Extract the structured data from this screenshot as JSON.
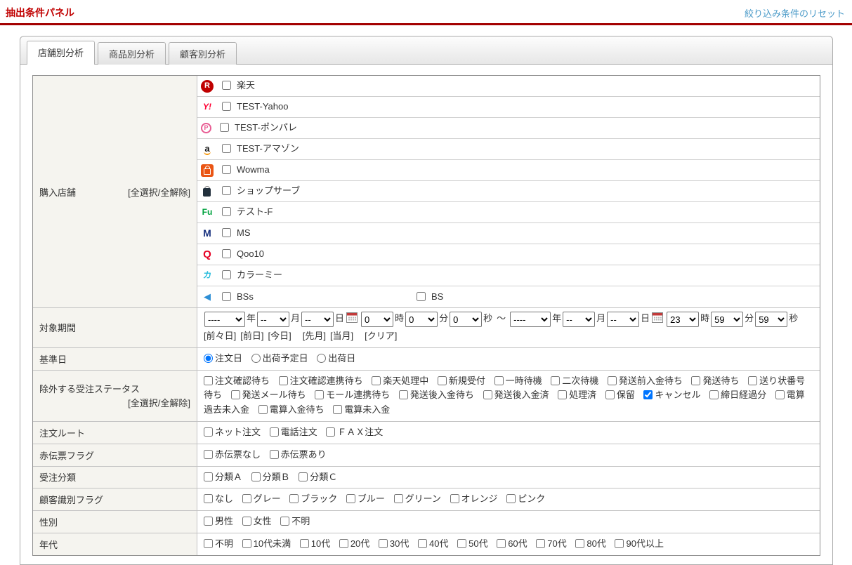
{
  "colors": {
    "title_red": "#c00000",
    "divider_red": "#a30000",
    "link_blue": "#4a9ac8",
    "checked_blue": "#1a73e8",
    "rakuten_red": "#bf0000",
    "wowma_orange": "#ea5514"
  },
  "page": {
    "title": "抽出条件パネル",
    "reset_link": "絞り込み条件のリセット"
  },
  "tabs": [
    {
      "label": "店舗別分析",
      "active": true
    },
    {
      "label": "商品別分析",
      "active": false
    },
    {
      "label": "顧客別分析",
      "active": false
    }
  ],
  "store_row": {
    "label": "購入店舗",
    "select_all_label": "[全選択/全解除]",
    "stores": [
      {
        "icon": "rakuten",
        "icon_text": "R",
        "label": "楽天"
      },
      {
        "icon": "yahoo",
        "icon_text": "Y!",
        "label": "TEST-Yahoo"
      },
      {
        "icon": "ponpare",
        "icon_text": "P",
        "label": "TEST-ポンパレ"
      },
      {
        "icon": "amazon",
        "icon_text": "a",
        "label": "TEST-アマゾン"
      },
      {
        "icon": "wowma",
        "icon_text": "",
        "label": "Wowma"
      },
      {
        "icon": "shopserve",
        "icon_text": "",
        "label": "ショップサーブ"
      },
      {
        "icon": "futureshop",
        "icon_text": "Fu",
        "label": "テスト-F"
      },
      {
        "icon": "makeshop",
        "icon_text": "M",
        "label": "MS"
      },
      {
        "icon": "qoo10",
        "icon_text": "Q",
        "label": "Qoo10"
      },
      {
        "icon": "colorme",
        "icon_text": "カ",
        "label": "カラーミー"
      },
      {
        "icon": "bss",
        "icon_text": "◀",
        "label": "BSs",
        "second_label": "BS"
      }
    ]
  },
  "period_row": {
    "label": "対象期間",
    "from": {
      "year": "----",
      "month": "--",
      "day": "--",
      "hour": "0",
      "minute": "0",
      "second": "0"
    },
    "to": {
      "year": "----",
      "month": "--",
      "day": "--",
      "hour": "23",
      "minute": "59",
      "second": "59"
    },
    "units": {
      "year": "年",
      "month": "月",
      "day": "日",
      "hour": "時",
      "minute": "分",
      "second": "秒"
    },
    "separator": "～",
    "quick_links": [
      "[前々日]",
      "[前日]",
      "[今日]",
      "[先月]",
      "[当月]",
      "[クリア]"
    ]
  },
  "basis_row": {
    "label": "基準日",
    "options": [
      {
        "label": "注文日",
        "checked": true
      },
      {
        "label": "出荷予定日",
        "checked": false
      },
      {
        "label": "出荷日",
        "checked": false
      }
    ]
  },
  "status_row": {
    "label": "除外する受注ステータス",
    "select_all_label": "[全選択/全解除]",
    "options": [
      {
        "label": "注文確認待ち",
        "checked": false
      },
      {
        "label": "注文確認連携待ち",
        "checked": false
      },
      {
        "label": "楽天処理中",
        "checked": false
      },
      {
        "label": "新規受付",
        "checked": false
      },
      {
        "label": "一時待機",
        "checked": false
      },
      {
        "label": "二次待機",
        "checked": false
      },
      {
        "label": "発送前入金待ち",
        "checked": false
      },
      {
        "label": "発送待ち",
        "checked": false
      },
      {
        "label": "送り状番号待ち",
        "checked": false
      },
      {
        "label": "発送メール待ち",
        "checked": false
      },
      {
        "label": "モール連携待ち",
        "checked": false
      },
      {
        "label": "発送後入金待ち",
        "checked": false
      },
      {
        "label": "発送後入金済",
        "checked": false
      },
      {
        "label": "処理済",
        "checked": false
      },
      {
        "label": "保留",
        "checked": false
      },
      {
        "label": "キャンセル",
        "checked": true
      },
      {
        "label": "締日経過分",
        "checked": false
      },
      {
        "label": "電算過去未入金",
        "checked": false
      },
      {
        "label": "電算入金待ち",
        "checked": false
      },
      {
        "label": "電算未入金",
        "checked": false
      }
    ]
  },
  "route_row": {
    "label": "注文ルート",
    "options": [
      "ネット注文",
      "電話注文",
      "ＦＡＸ注文"
    ]
  },
  "red_slip_row": {
    "label": "赤伝票フラグ",
    "options": [
      "赤伝票なし",
      "赤伝票あり"
    ]
  },
  "order_class_row": {
    "label": "受注分類",
    "options": [
      "分類Ａ",
      "分類Ｂ",
      "分類Ｃ"
    ]
  },
  "customer_flag_row": {
    "label": "顧客識別フラグ",
    "options": [
      "なし",
      "グレー",
      "ブラック",
      "ブルー",
      "グリーン",
      "オレンジ",
      "ピンク"
    ]
  },
  "gender_row": {
    "label": "性別",
    "options": [
      "男性",
      "女性",
      "不明"
    ]
  },
  "age_row": {
    "label": "年代",
    "options": [
      "不明",
      "10代未満",
      "10代",
      "20代",
      "30代",
      "40代",
      "50代",
      "60代",
      "70代",
      "80代",
      "90代以上"
    ]
  }
}
